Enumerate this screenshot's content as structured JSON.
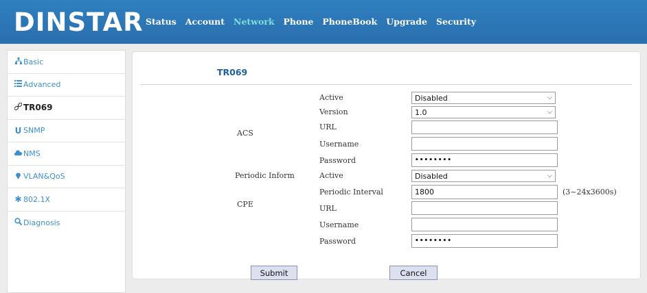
{
  "brand": {
    "logo_text": "DINSTAR"
  },
  "nav": [
    "Status",
    "Account",
    "Network",
    "Phone",
    "PhoneBook",
    "Upgrade",
    "Security"
  ],
  "nav_active": "Network",
  "sidebar": {
    "items": [
      {
        "label": "Basic",
        "icon": "sitemap-icon"
      },
      {
        "label": "Advanced",
        "icon": "list-icon"
      },
      {
        "label": "TR069",
        "icon": "link-icon"
      },
      {
        "label": "SNMP",
        "icon": "u-icon"
      },
      {
        "label": "NMS",
        "icon": "cloud-icon"
      },
      {
        "label": "VLAN&QoS",
        "icon": "pin-icon"
      },
      {
        "label": "802.1X",
        "icon": "asterisk-icon"
      },
      {
        "label": "Diagnosis",
        "icon": "magnifier-icon"
      }
    ],
    "active": "TR069"
  },
  "page": {
    "title": "TR069"
  },
  "form": {
    "acs": {
      "group_label": "ACS",
      "active": {
        "label": "Active",
        "value": "Disabled"
      },
      "version": {
        "label": "Version",
        "value": "1.0"
      },
      "url": {
        "label": "URL",
        "value": ""
      },
      "username": {
        "label": "Username",
        "value": ""
      },
      "password": {
        "label": "Password",
        "value": "••••••••"
      }
    },
    "periodic": {
      "group_label": "Periodic Inform",
      "active": {
        "label": "Active",
        "value": "Disabled"
      },
      "interval": {
        "label": "Periodic Interval",
        "value": "1800",
        "hint": "(3~24x3600s)"
      }
    },
    "cpe": {
      "group_label": "CPE",
      "url": {
        "label": "URL",
        "value": ""
      },
      "username": {
        "label": "Username",
        "value": ""
      },
      "password": {
        "label": "Password",
        "value": "••••••••"
      }
    }
  },
  "buttons": {
    "submit": "Submit",
    "cancel": "Cancel"
  }
}
